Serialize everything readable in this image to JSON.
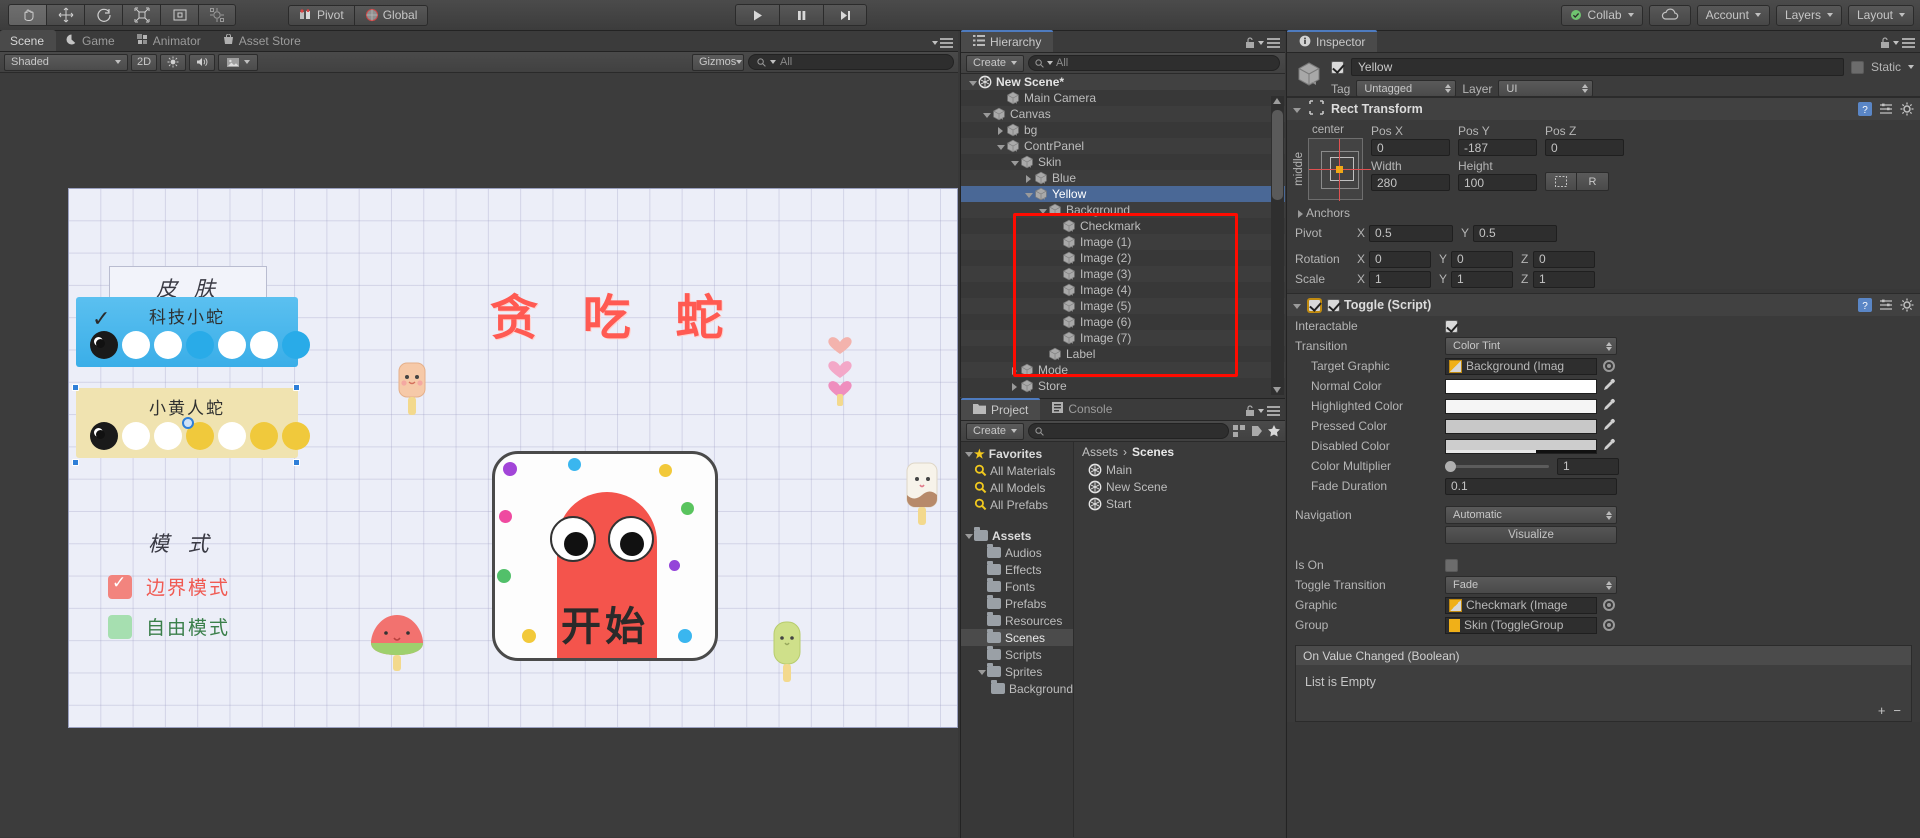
{
  "toolbar": {
    "tools": [
      {
        "name": "hand-tool",
        "active": true
      },
      {
        "name": "move-tool",
        "active": false
      },
      {
        "name": "rotate-tool",
        "active": false
      },
      {
        "name": "scale-tool",
        "active": false
      },
      {
        "name": "rect-tool",
        "active": false
      },
      {
        "name": "transform-tool",
        "active": false
      }
    ],
    "pivot_label": "Pivot",
    "global_label": "Global",
    "play_label": "▶",
    "pause_label": "❙❙",
    "step_label": "▶▏",
    "collab_label": "Collab",
    "account_label": "Account",
    "layers_label": "Layers",
    "layout_label": "Layout"
  },
  "scene_dock": {
    "tabs": [
      {
        "label": "Scene",
        "icon": "scene-icon",
        "active": true
      },
      {
        "label": "Game",
        "icon": "game-icon",
        "active": false
      },
      {
        "label": "Animator",
        "icon": "animator-icon",
        "active": false
      },
      {
        "label": "Asset Store",
        "icon": "asset-store-icon",
        "active": false
      }
    ],
    "shading_mode": "Shaded",
    "mode_2d": "2D",
    "gizmos_label": "Gizmos",
    "search_placeholder": "All"
  },
  "scene_content": {
    "skin_title": "皮 肤",
    "toggle_blue_label": "科技小蛇",
    "toggle_yellow_label": "小黄人蛇",
    "mode_title": "模 式",
    "mode_option_1": "边界模式",
    "mode_option_2": "自由模式",
    "game_title": "贪 吃 蛇",
    "start_label": "开始",
    "colors": {
      "blue_card": "#4cb7ec",
      "yellow_card": "#f0e3b0",
      "title_red": "#ff5a52",
      "snake_red": "#f4544c",
      "mode_red_box": "#f2847e",
      "mode_green_box": "#a6dfb0"
    }
  },
  "hierarchy": {
    "tab_label": "Hierarchy",
    "create_label": "Create",
    "search_placeholder": "All",
    "scene_name": "New Scene*",
    "items": [
      {
        "label": "Main Camera",
        "depth": 2,
        "twisty": "none",
        "selected": false
      },
      {
        "label": "Canvas",
        "depth": 1,
        "twisty": "down",
        "selected": false
      },
      {
        "label": "bg",
        "depth": 2,
        "twisty": "right",
        "selected": false
      },
      {
        "label": "ContrPanel",
        "depth": 2,
        "twisty": "down",
        "selected": false
      },
      {
        "label": "Skin",
        "depth": 3,
        "twisty": "down",
        "selected": false
      },
      {
        "label": "Blue",
        "depth": 4,
        "twisty": "right",
        "selected": false
      },
      {
        "label": "Yellow",
        "depth": 4,
        "twisty": "down",
        "selected": true
      },
      {
        "label": "Background",
        "depth": 5,
        "twisty": "down",
        "selected": false
      },
      {
        "label": "Checkmark",
        "depth": 6,
        "twisty": "none",
        "selected": false
      },
      {
        "label": "Image (1)",
        "depth": 6,
        "twisty": "none",
        "selected": false
      },
      {
        "label": "Image (2)",
        "depth": 6,
        "twisty": "none",
        "selected": false
      },
      {
        "label": "Image (3)",
        "depth": 6,
        "twisty": "none",
        "selected": false
      },
      {
        "label": "Image (4)",
        "depth": 6,
        "twisty": "none",
        "selected": false
      },
      {
        "label": "Image (5)",
        "depth": 6,
        "twisty": "none",
        "selected": false
      },
      {
        "label": "Image (6)",
        "depth": 6,
        "twisty": "none",
        "selected": false
      },
      {
        "label": "Image (7)",
        "depth": 6,
        "twisty": "none",
        "selected": false
      },
      {
        "label": "Label",
        "depth": 5,
        "twisty": "none",
        "selected": false
      },
      {
        "label": "Mode",
        "depth": 3,
        "twisty": "right",
        "selected": false
      },
      {
        "label": "Store",
        "depth": 3,
        "twisty": "right",
        "selected": false
      }
    ]
  },
  "project": {
    "tabs": [
      {
        "label": "Project",
        "icon": "project-icon",
        "active": true
      },
      {
        "label": "Console",
        "icon": "console-icon",
        "active": false
      }
    ],
    "create_label": "Create",
    "search_placeholder": "",
    "favorites_label": "Favorites",
    "favorites": [
      "All Materials",
      "All Models",
      "All Prefabs"
    ],
    "assets_label": "Assets",
    "folders": [
      {
        "label": "Audios",
        "depth": 1,
        "selected": false,
        "twisty": "none"
      },
      {
        "label": "Effects",
        "depth": 1,
        "selected": false,
        "twisty": "none"
      },
      {
        "label": "Fonts",
        "depth": 1,
        "selected": false,
        "twisty": "none"
      },
      {
        "label": "Prefabs",
        "depth": 1,
        "selected": false,
        "twisty": "none"
      },
      {
        "label": "Resources",
        "depth": 1,
        "selected": false,
        "twisty": "none"
      },
      {
        "label": "Scenes",
        "depth": 1,
        "selected": true,
        "twisty": "none"
      },
      {
        "label": "Scripts",
        "depth": 1,
        "selected": false,
        "twisty": "none"
      },
      {
        "label": "Sprites",
        "depth": 1,
        "selected": false,
        "twisty": "down"
      },
      {
        "label": "Background",
        "depth": 2,
        "selected": false,
        "twisty": "none"
      }
    ],
    "breadcrumb_root": "Assets",
    "breadcrumb_current": "Scenes",
    "scene_assets": [
      "Main",
      "New Scene",
      "Start"
    ]
  },
  "inspector": {
    "tab_label": "Inspector",
    "object_name": "Yellow",
    "object_enabled": true,
    "static_label": "Static",
    "static_checked": false,
    "tag_label": "Tag",
    "tag_value": "Untagged",
    "layer_label": "Layer",
    "layer_value": "UI",
    "rect_transform": {
      "title": "Rect Transform",
      "anchor_preset_top": "center",
      "anchor_preset_side": "middle",
      "pos_x_label": "Pos X",
      "pos_x": "0",
      "pos_y_label": "Pos Y",
      "pos_y": "-187",
      "pos_z_label": "Pos Z",
      "pos_z": "0",
      "width_label": "Width",
      "width": "280",
      "height_label": "Height",
      "height": "100",
      "blueprint_btn": "⬚",
      "raw_btn": "R",
      "anchors_label": "Anchors",
      "pivot_label": "Pivot",
      "pivot_x": "0.5",
      "pivot_y": "0.5",
      "rotation_label": "Rotation",
      "rot_x": "0",
      "rot_y": "0",
      "rot_z": "0",
      "scale_label": "Scale",
      "scale_x": "1",
      "scale_y": "1",
      "scale_z": "1"
    },
    "toggle_script": {
      "title": "Toggle (Script)",
      "interactable_label": "Interactable",
      "interactable": true,
      "transition_label": "Transition",
      "transition_value": "Color Tint",
      "target_graphic_label": "Target Graphic",
      "target_graphic_value": "Background (Imag",
      "normal_color_label": "Normal Color",
      "normal_color": "#ffffff",
      "highlighted_color_label": "Highlighted Color",
      "highlighted_color": "#f5f5f5",
      "pressed_color_label": "Pressed Color",
      "pressed_color": "#c8c8c8",
      "disabled_color_label": "Disabled Color",
      "disabled_color": "#cdcdcd",
      "color_multiplier_label": "Color Multiplier",
      "color_multiplier": "1",
      "fade_duration_label": "Fade Duration",
      "fade_duration": "0.1",
      "navigation_label": "Navigation",
      "navigation_value": "Automatic",
      "visualize_label": "Visualize",
      "is_on_label": "Is On",
      "is_on": false,
      "toggle_transition_label": "Toggle Transition",
      "toggle_transition_value": "Fade",
      "graphic_label": "Graphic",
      "graphic_value": "Checkmark (Image",
      "group_label": "Group",
      "group_value": "Skin (ToggleGroup",
      "event_title": "On Value Changed (Boolean)",
      "event_empty": "List is Empty",
      "event_add": "+",
      "event_remove": "−"
    }
  }
}
